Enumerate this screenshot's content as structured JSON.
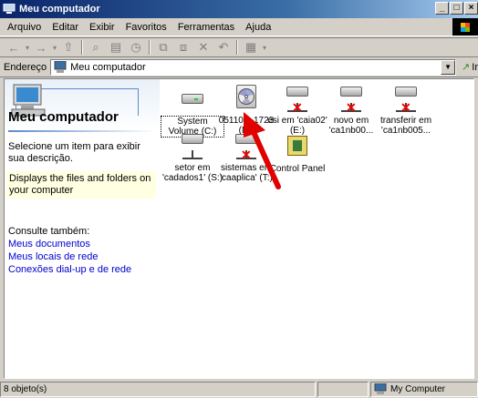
{
  "window": {
    "title": "Meu computador",
    "controls": [
      "_",
      "□",
      "×"
    ]
  },
  "menu": [
    "Arquivo",
    "Editar",
    "Exibir",
    "Favoritos",
    "Ferramentas",
    "Ajuda"
  ],
  "address": {
    "label": "Endereço",
    "value": "Meu computador",
    "go_label": "Ir"
  },
  "left_pane": {
    "title": "Meu computador",
    "prompt": "Selecione um item para exibir sua descrição.",
    "hint": "Displays the files and folders on your computer",
    "see_also": "Consulte também:",
    "links": [
      "Meus documentos",
      "Meus locais de rede",
      "Conexões dial-up e de rede"
    ]
  },
  "items": [
    {
      "label": "System Volume (C:)",
      "icon": "hard-drive-icon"
    },
    {
      "label": "051101_1723 (D:)",
      "icon": "cd-drive-icon"
    },
    {
      "label": "esi em 'caia02' (E:)",
      "icon": "disconnected-network-drive-icon"
    },
    {
      "label": "novo em 'ca1nb00...",
      "icon": "disconnected-network-drive-icon"
    },
    {
      "label": "transferir em 'ca1nb005...",
      "icon": "disconnected-network-drive-icon"
    },
    {
      "label": "setor em 'cadados1' (S:)",
      "icon": "network-drive-icon"
    },
    {
      "label": "sistemas em 'caaplica' (T:)",
      "icon": "disconnected-network-drive-icon"
    },
    {
      "label": "Control Panel",
      "icon": "control-panel-icon"
    }
  ],
  "status": {
    "count": "8 objeto(s)",
    "zone": "My Computer"
  },
  "colors": {
    "titlebar": "#0a246a",
    "link": "#0000cc",
    "annotation_arrow": "#e00000"
  }
}
